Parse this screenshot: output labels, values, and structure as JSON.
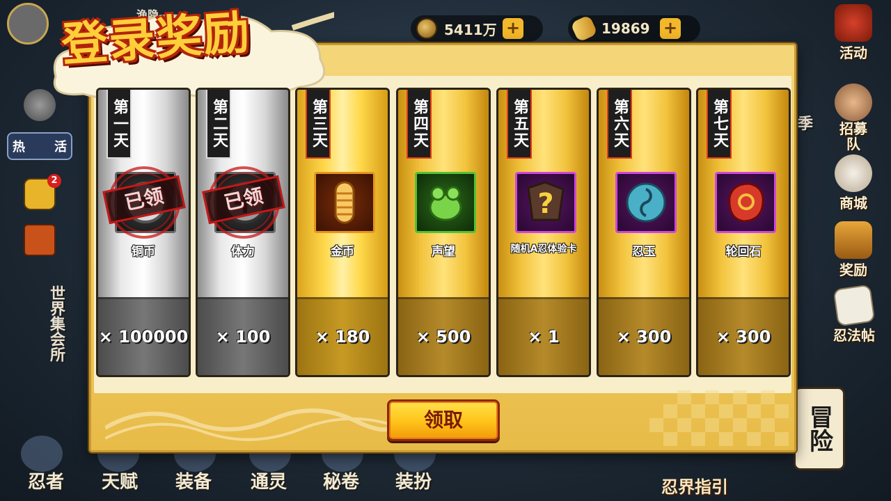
{
  "hud": {
    "coins": "5411万",
    "gold": "19869",
    "player_name_partial": "渔隐"
  },
  "right_menu": [
    {
      "label": "活动",
      "icon": "bell-gift-icon"
    },
    {
      "label": "招募\n队",
      "icon": "ninja-head-icon"
    },
    {
      "label": "商城",
      "icon": "lucky-cat-icon"
    },
    {
      "label": "奖励",
      "icon": "gift-box-icon"
    },
    {
      "label": "忍法帖",
      "icon": "scroll-card-icon"
    }
  ],
  "left_labels": {
    "hot": "热",
    "activity": "活",
    "mail_badge": "2",
    "world": "世界",
    "gathering": "集会所",
    "season": "季"
  },
  "bottom_menu": [
    {
      "label": "忍者"
    },
    {
      "label": "天赋"
    },
    {
      "label": "装备"
    },
    {
      "label": "通灵"
    },
    {
      "label": "秘卷"
    },
    {
      "label": "装扮"
    }
  ],
  "guide_label": "忍界指引",
  "adventure_label": "冒险",
  "dialog": {
    "title": "登录奖励",
    "claim_button": "领取",
    "claimed_stamp": "已领",
    "days": [
      {
        "day": "第一天",
        "item": "铜币",
        "count": "× 100000",
        "claimed": true,
        "style": "silver",
        "icon": "copper-coin-icon"
      },
      {
        "day": "第二天",
        "item": "体力",
        "count": "× 100",
        "claimed": true,
        "style": "silver",
        "icon": "stamina-icon"
      },
      {
        "day": "第三天",
        "item": "金币",
        "count": "× 180",
        "claimed": false,
        "style": "gold-active",
        "icon": "gold-ingot-icon"
      },
      {
        "day": "第四天",
        "item": "声望",
        "count": "× 500",
        "claimed": false,
        "style": "gold",
        "icon": "green-toad-icon"
      },
      {
        "day": "第五天",
        "item": "随机A忍体验卡",
        "count": "× 1",
        "claimed": false,
        "style": "gold",
        "icon": "mystery-ninja-card-icon"
      },
      {
        "day": "第六天",
        "item": "忍玉",
        "count": "× 300",
        "claimed": false,
        "style": "gold",
        "icon": "ninja-jade-icon"
      },
      {
        "day": "第七天",
        "item": "轮回石",
        "count": "× 300",
        "claimed": false,
        "style": "gold",
        "icon": "reincarnation-stone-icon"
      }
    ]
  }
}
